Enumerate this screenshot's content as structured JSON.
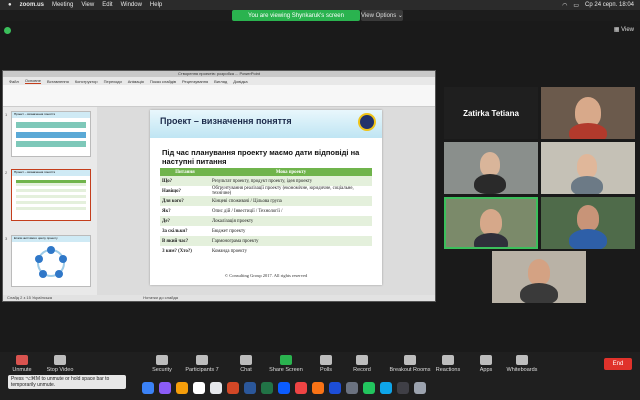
{
  "menubar": {
    "app_name": "zoom.us",
    "items": [
      "Meeting",
      "View",
      "Edit",
      "Window",
      "Help"
    ],
    "datetime": "Ср 24 серп. 18:04"
  },
  "share": {
    "banner": "You are viewing Shynkaruk's screen",
    "view_options": "View Options",
    "view_button": "View"
  },
  "ppt": {
    "window_title": "Створення проектів: розробка ... PowerPoint",
    "tabs": [
      "Файл",
      "Основне",
      "Вставлення",
      "Конструктор",
      "Переходи",
      "Анімація",
      "Показ слайдів",
      "Рецензування",
      "Вигляд",
      "Довідка"
    ],
    "status_text": "Слайд 2 з 15   Українська",
    "notes_hint": "Нотатки до слайда"
  },
  "slide": {
    "title": "Проект – визначення поняття",
    "question": "Під час планування проекту маємо дати відповіді на наступні питання",
    "table_headers": [
      "Питання",
      "Мова проекту"
    ],
    "rows": [
      {
        "q": "Що?",
        "a": "Результат проекту, продукт проекту, ідея проекту"
      },
      {
        "q": "Навіщо?",
        "a": "Обґрунтування реалізації проекту (економічне, юридичне, соціальне, технічне)"
      },
      {
        "q": "Для кого?",
        "a": "Кінцеві споживачі / Цільова група"
      },
      {
        "q": "Як?",
        "a": "Опис дій / Інвестиції / Технології /"
      },
      {
        "q": "Де?",
        "a": "Локалізація проекту"
      },
      {
        "q": "За скільки?",
        "a": "Бюджет проекту"
      },
      {
        "q": "В який час?",
        "a": "Гармонограма проекту"
      },
      {
        "q": "З ким? (Хто?)",
        "a": "Команда проекту"
      }
    ],
    "footer": "© Consulting Group 2017. All rights reserved"
  },
  "thumbs": [
    {
      "num": "1",
      "title": "Проект – визначення поняття"
    },
    {
      "num": "2",
      "title": "Проект – визначення поняття"
    },
    {
      "num": "3",
      "title": "Етапи життєвого циклу проекту"
    }
  ],
  "participants": [
    {
      "name": "Zatirka Tetiana"
    }
  ],
  "toolbar": {
    "unmute": "Unmute",
    "stop_video": "Stop Video",
    "security": "Security",
    "participants": "Participants",
    "participants_count": "7",
    "chat": "Chat",
    "share_screen": "Share Screen",
    "polls": "Polls",
    "record": "Record",
    "breakout_rooms": "Breakout Rooms",
    "reactions": "Reactions",
    "apps": "Apps",
    "whiteboards": "Whiteboards",
    "end": "End",
    "tooltip": "Press ⌥⌘M to unmute or hold space bar to temporarily unmute."
  },
  "colors": {
    "share_green": "#2ab34f",
    "table_header_green": "#70b44c",
    "end_red": "#e0322b"
  }
}
